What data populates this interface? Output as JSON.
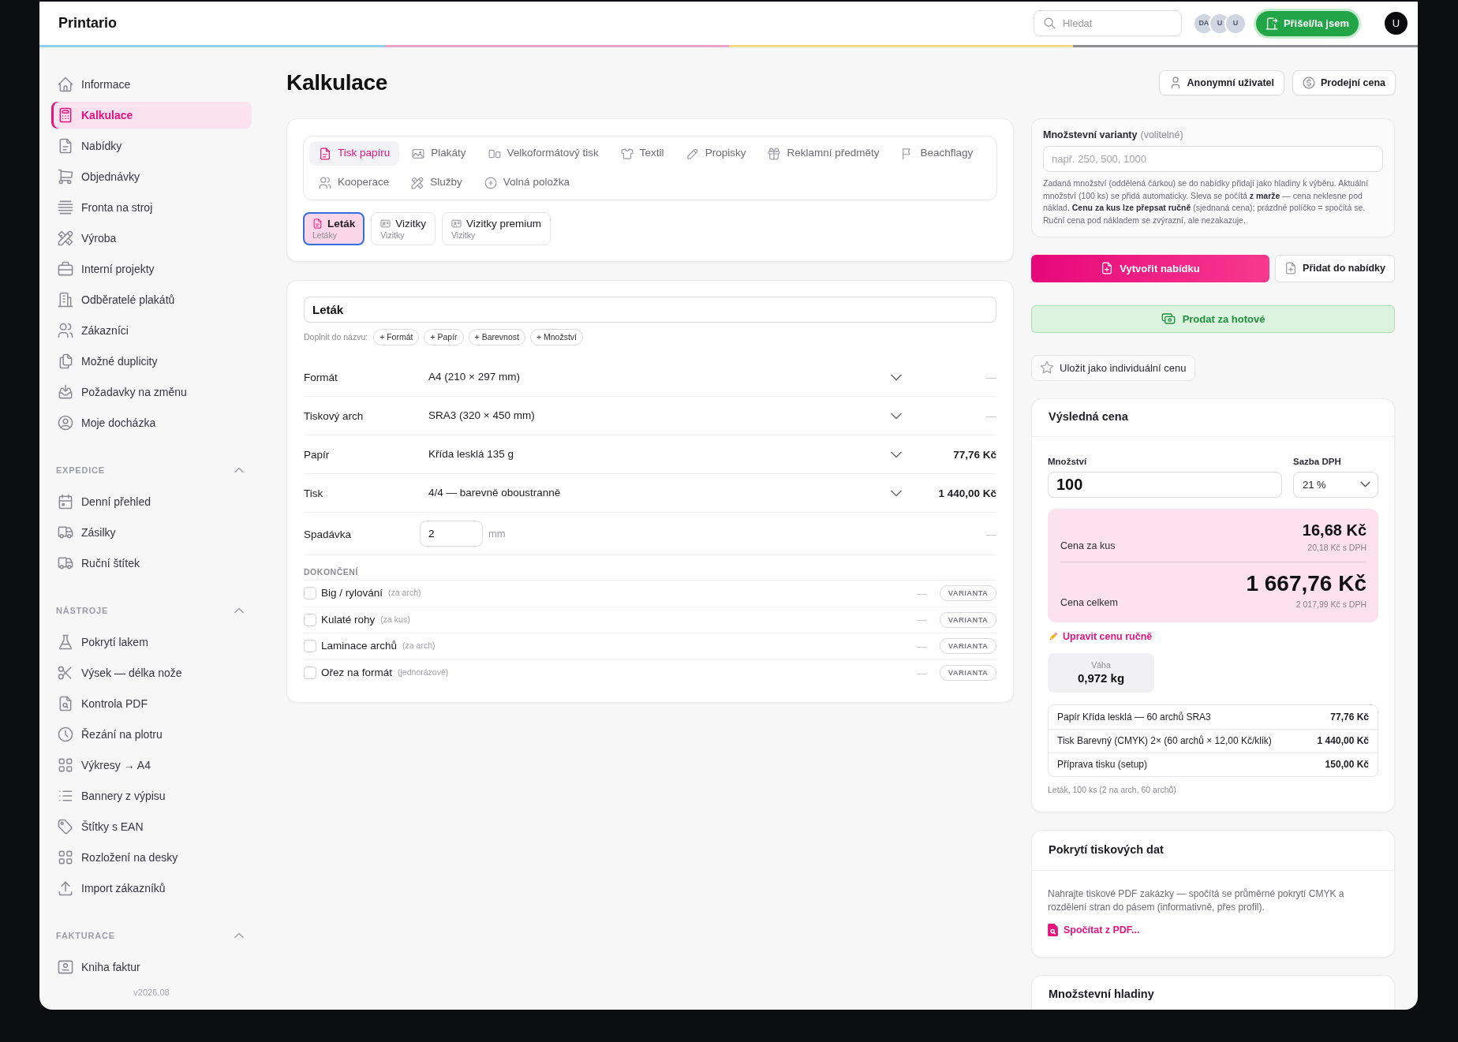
{
  "topbar": {
    "brand": "Printario",
    "search_placeholder": "Hledat",
    "online_users": [
      "DA",
      "U",
      "U"
    ],
    "checkin_button": "Přišel/la jsem",
    "user_avatar": "U"
  },
  "sidebar": {
    "items": [
      {
        "label": "Informace",
        "selected": false
      },
      {
        "label": "Kalkulace",
        "selected": true
      },
      {
        "label": "Nabídky",
        "selected": false
      },
      {
        "label": "Objednávky",
        "selected": false
      },
      {
        "label": "Fronta na stroj",
        "selected": false
      },
      {
        "label": "Výroba",
        "selected": false
      },
      {
        "label": "Interní projekty",
        "selected": false
      },
      {
        "label": "Odběratelé plakátů",
        "selected": false
      },
      {
        "label": "Zákazníci",
        "selected": false
      },
      {
        "label": "Možné duplicity",
        "selected": false
      },
      {
        "label": "Požadavky na změnu",
        "selected": false
      },
      {
        "label": "Moje docházka",
        "selected": false
      }
    ],
    "sections": [
      {
        "title": "EXPEDICE",
        "expanded": true,
        "items": [
          {
            "label": "Denní přehled",
            "selected": false
          },
          {
            "label": "Zásilky",
            "selected": false
          },
          {
            "label": "Ruční štítek",
            "selected": false
          }
        ]
      },
      {
        "title": "NÁSTROJE",
        "expanded": true,
        "items": [
          {
            "label": "Pokrytí lakem",
            "selected": false
          },
          {
            "label": "Výsek — délka nože",
            "selected": false
          },
          {
            "label": "Kontrola PDF",
            "selected": false
          },
          {
            "label": "Řezání na plotru",
            "selected": false
          },
          {
            "label": "Výkresy → A4",
            "selected": false
          },
          {
            "label": "Bannery z výpisu",
            "selected": false
          },
          {
            "label": "Štítky s EAN",
            "selected": false
          },
          {
            "label": "Rozložení na desky",
            "selected": false
          },
          {
            "label": "Import zákazníků",
            "selected": false
          }
        ]
      },
      {
        "title": "FAKTURACE",
        "expanded": true,
        "items": [
          {
            "label": "Kniha faktur",
            "selected": false
          }
        ]
      }
    ],
    "version": "v2026.08"
  },
  "page": {
    "title": "Kalkulace",
    "header_buttons": [
      "Anonymní uživatel",
      "Prodejní cena"
    ]
  },
  "categories": [
    {
      "label": "Tisk papíru",
      "selected": true
    },
    {
      "label": "Plakáty",
      "selected": false
    },
    {
      "label": "Velkoformátový tisk",
      "selected": false
    },
    {
      "label": "Textil",
      "selected": false
    },
    {
      "label": "Propisky",
      "selected": false
    },
    {
      "label": "Reklamní předměty",
      "selected": false
    },
    {
      "label": "Beachflagy",
      "selected": false
    },
    {
      "label": "Kooperace",
      "selected": false
    },
    {
      "label": "Služby",
      "selected": false
    },
    {
      "label": "Volná položka",
      "selected": false
    }
  ],
  "product_types": [
    {
      "title": "Leták",
      "subtitle": "Letáky",
      "selected": true
    },
    {
      "title": "Vizitky",
      "subtitle": "Vizitky",
      "selected": false
    },
    {
      "title": "Vizitky premium",
      "subtitle": "Vizitky",
      "selected": false
    }
  ],
  "form": {
    "name": "Leták",
    "append_label": "Doplnit do názvu:",
    "append_chips": [
      "+ Formát",
      "+ Papír",
      "+ Barevnost",
      "+ Množství"
    ],
    "rows": [
      {
        "kind": "select",
        "label": "Formát",
        "value": "A4 (210 × 297 mm)",
        "price": "—",
        "price_empty": true
      },
      {
        "kind": "select",
        "label": "Tiskový arch",
        "value": "SRA3 (320 × 450 mm)",
        "price": "—",
        "price_empty": true
      },
      {
        "kind": "select",
        "label": "Papír",
        "value": "Křída lesklá 135 g",
        "price": "77,76 Kč",
        "price_empty": false
      },
      {
        "kind": "select",
        "label": "Tisk",
        "value": "4/4 — barevně oboustranně",
        "price": "1 440,00 Kč",
        "price_empty": false
      },
      {
        "kind": "number",
        "label": "Spadávka",
        "value": "2",
        "unit": "mm",
        "price": "—",
        "price_empty": true
      }
    ],
    "finishing_title": "DOKONČENÍ",
    "finishing": [
      {
        "label": "Big / rylování",
        "note": "(za arch)",
        "checked": false,
        "price": "—",
        "button": "VARIANTA"
      },
      {
        "label": "Kulaté rohy",
        "note": "(za kus)",
        "checked": false,
        "price": "—",
        "button": "VARIANTA"
      },
      {
        "label": "Laminace archů",
        "note": "(za arch)",
        "checked": false,
        "price": "—",
        "button": "VARIANTA"
      },
      {
        "label": "Ořez na formát",
        "note": "(jednorázově)",
        "checked": false,
        "price": "—",
        "button": "VARIANTA"
      }
    ]
  },
  "quantity_variants": {
    "label": "Množstevní varianty",
    "optional_note": "(volitelné)",
    "placeholder": "např. 250, 500, 1000",
    "help": "Zadaná množství (oddělená čárkou) se do nabídky přidají jako hladiny k výběru. Aktuální množství (100 ks) se přidá automaticky. Sleva se počítá **z marže** — cena neklesne pod náklad. **Cenu za kus lze přepsat ručně** (sjednaná cena); prázdné políčko = spočítá se. Ruční cena pod nákladem se zvýrazní, ale nezakazuje."
  },
  "actions": {
    "create_offer": "Vytvořit nabídku",
    "add_to_offer": "Přidat do nabídky",
    "sell_cash": "Prodat za hotové",
    "save_price": "Uložit jako individuální cenu"
  },
  "result": {
    "title": "Výsledná cena",
    "quantity_label": "Množství",
    "quantity": "100",
    "vat_label": "Sazba DPH",
    "vat": "21 %",
    "unit_label": "Cena za kus",
    "unit_price": "16,68 Kč",
    "unit_price_vat": "20,18 Kč s DPH",
    "total_label": "Cena celkem",
    "total_price": "1 667,76 Kč",
    "total_price_vat": "2 017,99 Kč s DPH",
    "manual_link": "Upravit cenu ručně",
    "weight_label": "Váha",
    "weight": "0,972 kg",
    "breakdown": [
      {
        "item": "Papír Křída lesklá — 60 archů SRA3",
        "amount": "77,76 Kč"
      },
      {
        "item": "Tisk Barevný (CMYK) 2× (60 archů × 12,00 Kč/klik)",
        "amount": "1 440,00 Kč"
      },
      {
        "item": "Příprava tisku (setup)",
        "amount": "150,00 Kč"
      }
    ],
    "note": "Leták, 100 ks (2 na arch, 60 archů)"
  },
  "coverage": {
    "title": "Pokrytí tiskových dat",
    "text": "Nahrajte tiskové PDF zakázky — spočítá se průměrné pokrytí CMYK a rozdělení stran do pásem (informativně, přes profil).",
    "link": "Spočítat z PDF..."
  },
  "tiers_card": {
    "title": "Množstevní hladiny"
  }
}
